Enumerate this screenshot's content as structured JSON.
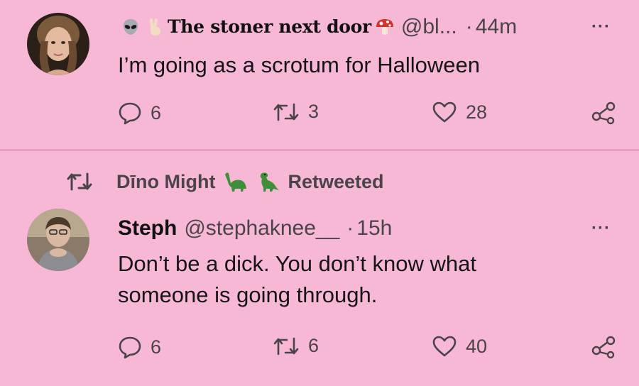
{
  "tweet1": {
    "display_name": "The stoner next door",
    "handle": "@bl...",
    "separator": "·",
    "time": "44m",
    "text": "I’m going as a scrotum for Halloween",
    "replies": "6",
    "retweets": "3",
    "likes": "28",
    "more_label": "···"
  },
  "retweet_banner": {
    "name": "Dīno Might",
    "label": "Retweeted"
  },
  "tweet2": {
    "display_name": "Steph",
    "handle": "@stephaknee__",
    "separator": "·",
    "time": "15h",
    "text_line1": "Don’t be a dick. You don’t know what",
    "text_line2": "someone is going through.",
    "replies": "6",
    "retweets": "6",
    "likes": "40",
    "more_label": "···"
  },
  "colors": {
    "background": "#f7b8d6",
    "divider": "#e9a1c3",
    "text_primary": "#151515",
    "text_secondary": "#4a4448",
    "dino_green": "#3f8f3a"
  },
  "icons": {
    "reply": "reply-icon",
    "retweet": "retweet-icon",
    "like": "heart-icon",
    "share": "share-icon",
    "more": "more-icon"
  }
}
